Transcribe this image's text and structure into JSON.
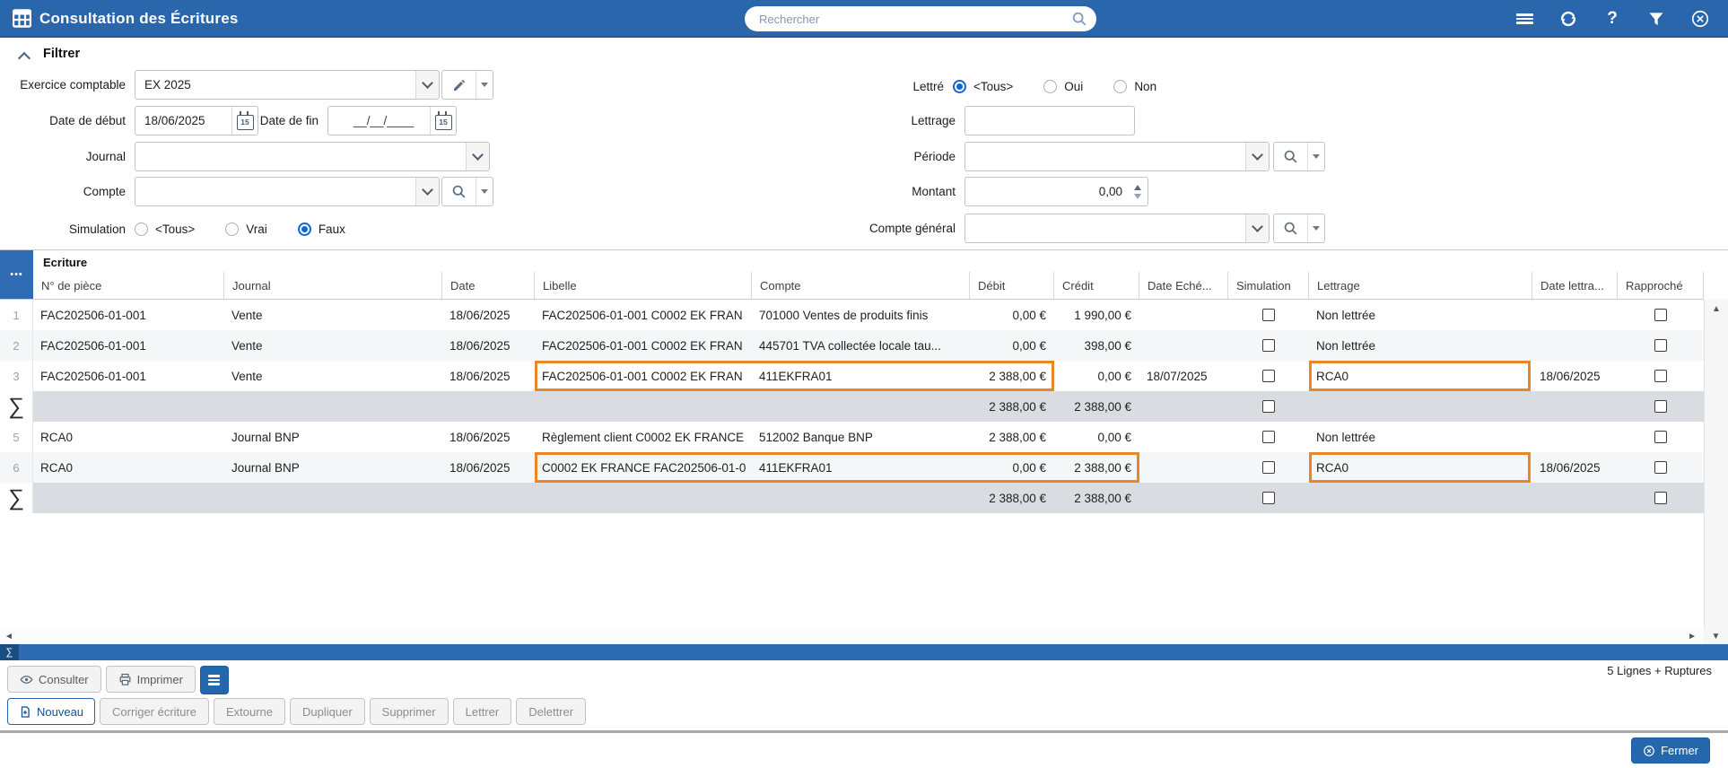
{
  "colors": {
    "accent": "#2a66ab",
    "highlight": "#ea8722",
    "sum_row": "#d9dce1"
  },
  "topbar": {
    "title": "Consultation des Écritures",
    "search_placeholder": "Rechercher"
  },
  "filter": {
    "title": "Filtrer",
    "exercice_label": "Exercice comptable",
    "exercice_value": "EX 2025",
    "date_debut_label": "Date de début",
    "date_debut_value": "18/06/2025",
    "date_fin_label": "Date de fin",
    "date_fin_placeholder": "__/__/____",
    "journal_label": "Journal",
    "journal_value": "",
    "compte_label": "Compte",
    "compte_value": "",
    "simulation_label": "Simulation",
    "simulation_options": [
      {
        "label": "<Tous>",
        "selected": false
      },
      {
        "label": "Vrai",
        "selected": false
      },
      {
        "label": "Faux",
        "selected": true
      }
    ],
    "lettre_label": "Lettré",
    "lettre_options": [
      {
        "label": "<Tous>",
        "selected": true
      },
      {
        "label": "Oui",
        "selected": false
      },
      {
        "label": "Non",
        "selected": false
      }
    ],
    "lettrage_label": "Lettrage",
    "lettrage_value": "",
    "periode_label": "Période",
    "periode_value": "",
    "montant_label": "Montant",
    "montant_value": "0,00",
    "compte_general_label": "Compte général",
    "compte_general_value": ""
  },
  "table": {
    "group_header": "Ecriture",
    "columns": [
      "N° de pièce",
      "Journal",
      "Date",
      "Libelle",
      "Compte",
      "Débit",
      "Crédit",
      "Date Eché...",
      "Simulation",
      "Lettrage",
      "Date lettra...",
      "Rapproché"
    ],
    "rows": [
      {
        "num": "1",
        "piece": "FAC202506-01-001",
        "journal": "Vente",
        "date": "18/06/2025",
        "libelle": "FAC202506-01-001 C0002 EK FRAN",
        "compte": "701000 Ventes de produits finis",
        "debit": "0,00 €",
        "credit": "1 990,00 €",
        "echeance": "",
        "lettrage": "Non lettrée",
        "date_lettrage": ""
      },
      {
        "num": "2",
        "piece": "FAC202506-01-001",
        "journal": "Vente",
        "date": "18/06/2025",
        "libelle": "FAC202506-01-001 C0002 EK FRAN",
        "compte": "445701 TVA collectée locale tau...",
        "debit": "0,00 €",
        "credit": "398,00 €",
        "echeance": "",
        "lettrage": "Non lettrée",
        "date_lettrage": ""
      },
      {
        "num": "3",
        "piece": "FAC202506-01-001",
        "journal": "Vente",
        "date": "18/06/2025",
        "libelle": "FAC202506-01-001 C0002 EK FRAN",
        "compte": "411EKFRA01",
        "debit": "2 388,00 €",
        "credit": "0,00 €",
        "echeance": "18/07/2025",
        "lettrage": "RCA0",
        "date_lettrage": "18/06/2025"
      },
      {
        "num": "∑",
        "piece": "",
        "journal": "",
        "date": "",
        "libelle": "",
        "compte": "",
        "debit": "2 388,00 €",
        "credit": "2 388,00 €",
        "echeance": "",
        "lettrage": "",
        "date_lettrage": ""
      },
      {
        "num": "5",
        "piece": "RCA0",
        "journal": "Journal BNP",
        "date": "18/06/2025",
        "libelle": "Règlement client C0002 EK FRANCE",
        "compte": "512002 Banque BNP",
        "debit": "2 388,00 €",
        "credit": "0,00 €",
        "echeance": "",
        "lettrage": "Non lettrée",
        "date_lettrage": ""
      },
      {
        "num": "6",
        "piece": "RCA0",
        "journal": "Journal BNP",
        "date": "18/06/2025",
        "libelle": "C0002 EK FRANCE FAC202506-01-0",
        "compte": "411EKFRA01",
        "debit": "0,00 €",
        "credit": "2 388,00 €",
        "echeance": "",
        "lettrage": "RCA0",
        "date_lettrage": "18/06/2025"
      },
      {
        "num": "∑",
        "piece": "",
        "journal": "",
        "date": "",
        "libelle": "",
        "compte": "",
        "debit": "2 388,00 €",
        "credit": "2 388,00 €",
        "echeance": "",
        "lettrage": "",
        "date_lettrage": ""
      }
    ]
  },
  "icons": {
    "row_menu": "•••",
    "sum": "∑",
    "help": "?",
    "calendar_day": "15",
    "scroll_up": "▲",
    "scroll_down": "▼",
    "scroll_left": "◄",
    "scroll_right": "►"
  },
  "toolbar": {
    "consulter_label": "Consulter",
    "imprimer_label": "Imprimer",
    "status": "5 Lignes + Ruptures",
    "nouveau_label": "Nouveau",
    "corriger_label": "Corriger écriture",
    "extourne_label": "Extourne",
    "dupliquer_label": "Dupliquer",
    "supprimer_label": "Supprimer",
    "lettrer_label": "Lettrer",
    "delettrer_label": "Delettrer"
  },
  "footer": {
    "fermer_label": "Fermer"
  }
}
